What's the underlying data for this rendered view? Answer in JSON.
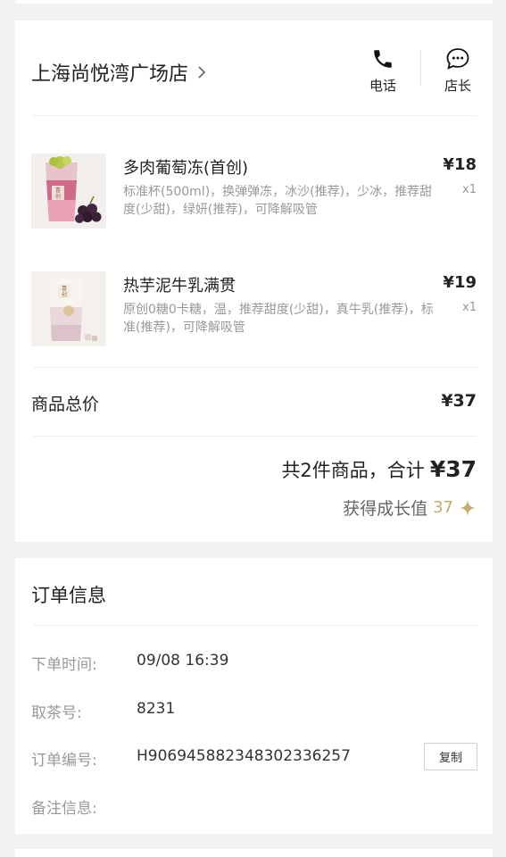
{
  "store": {
    "name": "上海尚悦湾广场店",
    "actions": {
      "phone_label": "电话",
      "manager_label": "店长"
    }
  },
  "items": [
    {
      "name": "多肉葡萄冻(首创)",
      "spec": "标准杯(500ml)，换弹弹冻，冰沙(推荐)，少冰，推荐甜度(少甜)，绿妍(推荐)，可降解吸管",
      "price": "¥18",
      "qty": "x1",
      "thumb_icon": "grape-drink-image",
      "cup_mark": "喜\n创"
    },
    {
      "name": "热芋泥牛乳满贯",
      "spec": "原创0糖0卡糖，温，推荐甜度(少甜)，真牛乳(推荐)，标准(推荐)，可降解吸管",
      "price": "¥19",
      "qty": "x1",
      "thumb_icon": "taro-milk-drink-image",
      "cup_mark": "喜\n创"
    }
  ],
  "totals": {
    "subtotal_label": "商品总价",
    "subtotal_value": "¥37",
    "summary_text": "共2件商品，合计",
    "summary_amount": "¥37",
    "growth_label": "获得成长值",
    "growth_value": "37"
  },
  "order": {
    "title": "订单信息",
    "time_label": "下单时间:",
    "time_value": "09/08 16:39",
    "pickup_label": "取茶号:",
    "pickup_value": "8231",
    "number_label": "订单编号:",
    "number_value": "H906945882348302336257",
    "copy_label": "复制",
    "note_label": "备注信息:"
  },
  "colors": {
    "background": "#f2f2f2",
    "gold_accent": "#c9a96e",
    "muted_text": "#999999"
  }
}
